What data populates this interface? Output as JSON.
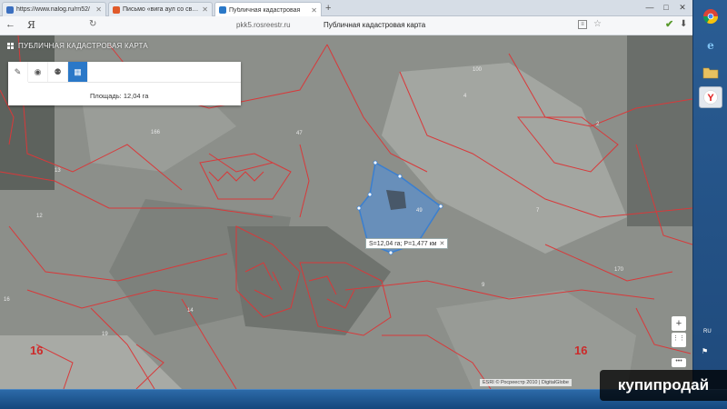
{
  "browser": {
    "tabs": [
      {
        "label": "https://www.nalog.ru/rn52/",
        "icon": "nalog-icon",
        "active": false
      },
      {
        "label": "Письмо «вига аул со своей»",
        "icon": "mail-icon",
        "active": false
      },
      {
        "label": "Публичная кадастровая",
        "icon": "rosreestr-icon",
        "active": true
      }
    ],
    "new_tab": "+",
    "url": "pkk5.rosreestr.ru",
    "page_title": "Публичная кадастровая карта",
    "back": "←",
    "logo": "Я",
    "window_controls": {
      "minimize": "—",
      "maximize": "□",
      "close": "✕"
    }
  },
  "map": {
    "app_title": "ПУБЛИЧНАЯ КАДАСТРОВАЯ КАРТА",
    "tools": [
      {
        "icon": "ruler-icon",
        "glyph": "✎",
        "active": false
      },
      {
        "icon": "eye-icon",
        "glyph": "◉",
        "active": false
      },
      {
        "icon": "people-icon",
        "glyph": "⚉",
        "active": false
      },
      {
        "icon": "measure-area-icon",
        "glyph": "▦",
        "active": true
      }
    ],
    "area_text": "Площадь: 12,04 га",
    "measure_label": "S=12,04 га; P=1,477 км",
    "measure_close": "✕",
    "zoom_in": "+",
    "zoom_out": "+",
    "layers": "⋮⋮",
    "more": "•••",
    "attribution": "ESRI © Росреестр 2010 | DigitalGlobe",
    "big_numbers": [
      "16",
      "16"
    ],
    "plot_numbers": [
      "47",
      "100",
      "12",
      "13",
      "16",
      "14",
      "4",
      "2",
      "9",
      "7",
      "49",
      "166",
      "170",
      "19"
    ]
  },
  "sidebar": {
    "lang": "RU"
  },
  "watermark": "купипродай",
  "colors": {
    "parcel_line": "#d8393a",
    "selection_fill": "#4a90e2",
    "taskbar": "#1f4a7c"
  }
}
